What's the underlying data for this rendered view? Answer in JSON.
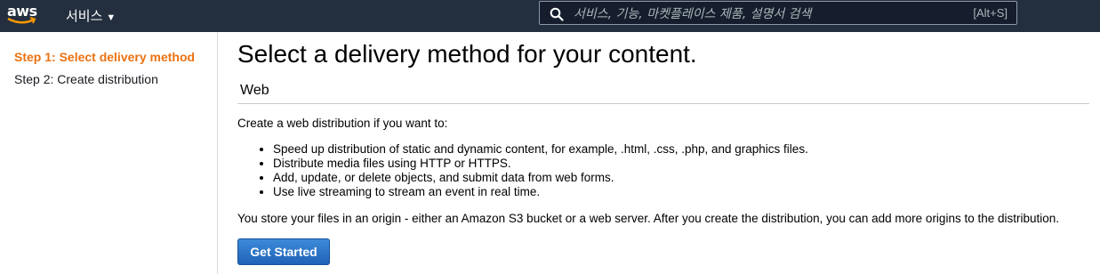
{
  "header": {
    "logo_text": "aws",
    "services_label": "서비스",
    "search": {
      "placeholder": "서비스, 기능, 마켓플레이스 제품, 설명서 검색",
      "shortcut": "[Alt+S]"
    }
  },
  "sidebar": {
    "steps": [
      {
        "label": "Step 1: Select delivery method",
        "active": true
      },
      {
        "label": "Step 2: Create distribution",
        "active": false
      }
    ]
  },
  "main": {
    "title": "Select a delivery method for your content.",
    "section_title": "Web",
    "intro": "Create a web distribution if you want to:",
    "features": [
      "Speed up distribution of static and dynamic content, for example, .html, .css, .php, and graphics files.",
      "Distribute media files using HTTP or HTTPS.",
      "Add, update, or delete objects, and submit data from web forms.",
      "Use live streaming to stream an event in real time."
    ],
    "origin_text": "You store your files in an origin - either an Amazon S3 bucket or a web server. After you create the distribution, you can add more origins to the distribution.",
    "cta_label": "Get Started"
  },
  "colors": {
    "topbar": "#232f3e",
    "active_step": "#ec7211",
    "button": "#1e62b7"
  }
}
